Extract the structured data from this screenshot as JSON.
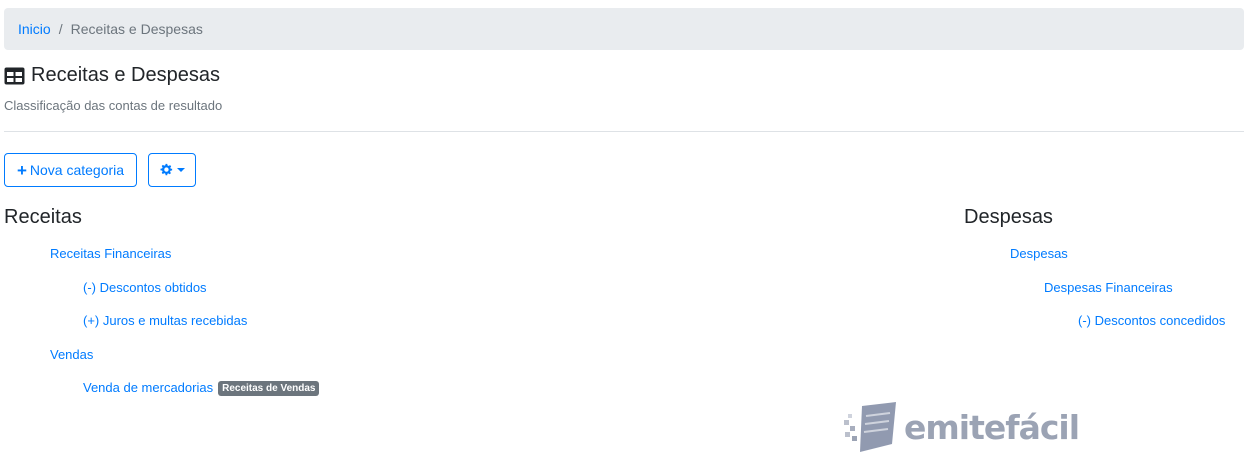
{
  "breadcrumb": {
    "home": "Inicio",
    "separator": "/",
    "current": "Receitas e Despesas"
  },
  "header": {
    "title": "Receitas e Despesas",
    "subtitle": "Classificação das contas de resultado",
    "icon": "table-icon"
  },
  "toolbar": {
    "new_category": "Nova categoria",
    "settings_icon": "gear-icon"
  },
  "receitas": {
    "title": "Receitas",
    "items": [
      {
        "label": "Receitas Financeiras",
        "level": 1
      },
      {
        "label": "(-) Descontos obtidos",
        "level": 2
      },
      {
        "label": "(+) Juros e multas recebidas",
        "level": 2
      },
      {
        "label": "Vendas",
        "level": 1
      },
      {
        "label": "Venda de mercadorias",
        "level": 2,
        "badge": "Receitas de Vendas"
      }
    ]
  },
  "despesas": {
    "title": "Despesas",
    "items": [
      {
        "label": "Despesas",
        "level": 1
      },
      {
        "label": "Despesas Financeiras",
        "level": 2
      },
      {
        "label": "(-) Descontos concedidos",
        "level": 3
      }
    ]
  },
  "watermark": {
    "text": "emitefácil"
  },
  "colors": {
    "link": "#007bff",
    "muted": "#6c757d",
    "breadcrumb_bg": "#e9ecef"
  }
}
